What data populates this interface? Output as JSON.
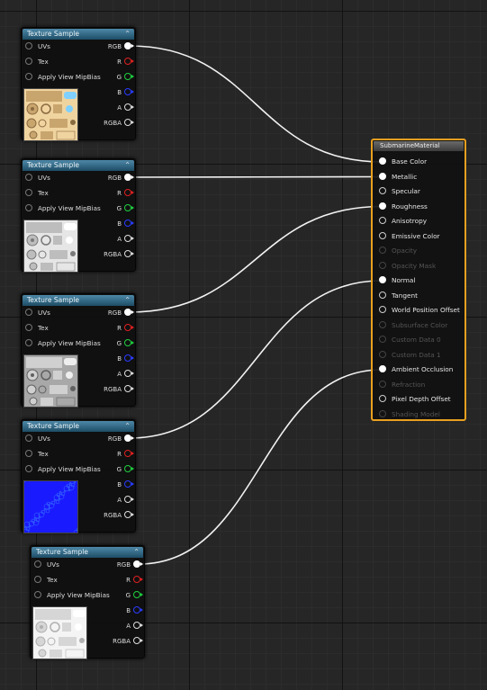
{
  "texture_nodes": [
    {
      "title": "Texture Sample",
      "inputs": [
        "UVs",
        "Tex",
        "Apply View MipBias"
      ],
      "outputs": [
        "RGB",
        "R",
        "G",
        "B",
        "A",
        "RGBA"
      ],
      "preview": "beige-diffuse-map"
    },
    {
      "title": "Texture Sample",
      "inputs": [
        "UVs",
        "Tex",
        "Apply View MipBias"
      ],
      "outputs": [
        "RGB",
        "R",
        "G",
        "B",
        "A",
        "RGBA"
      ],
      "preview": "grey-metallic-map"
    },
    {
      "title": "Texture Sample",
      "inputs": [
        "UVs",
        "Tex",
        "Apply View MipBias"
      ],
      "outputs": [
        "RGB",
        "R",
        "G",
        "B",
        "A",
        "RGBA"
      ],
      "preview": "grey-roughness-map"
    },
    {
      "title": "Texture Sample",
      "inputs": [
        "UVs",
        "Tex",
        "Apply View MipBias"
      ],
      "outputs": [
        "RGB",
        "R",
        "G",
        "B",
        "A",
        "RGBA"
      ],
      "preview": "blue-normal-map"
    },
    {
      "title": "Texture Sample",
      "inputs": [
        "UVs",
        "Tex",
        "Apply View MipBias"
      ],
      "outputs": [
        "RGB",
        "R",
        "G",
        "B",
        "A",
        "RGBA"
      ],
      "preview": "white-ao-map"
    }
  ],
  "material": {
    "title": "SubmarineMaterial",
    "pins": [
      {
        "label": "Base Color",
        "state": "connected"
      },
      {
        "label": "Metallic",
        "state": "connected"
      },
      {
        "label": "Specular",
        "state": "active"
      },
      {
        "label": "Roughness",
        "state": "connected"
      },
      {
        "label": "Anisotropy",
        "state": "active"
      },
      {
        "label": "Emissive Color",
        "state": "active"
      },
      {
        "label": "Opacity",
        "state": "disabled"
      },
      {
        "label": "Opacity Mask",
        "state": "disabled"
      },
      {
        "label": "Normal",
        "state": "connected"
      },
      {
        "label": "Tangent",
        "state": "active"
      },
      {
        "label": "World Position Offset",
        "state": "active"
      },
      {
        "label": "Subsurface Color",
        "state": "disabled"
      },
      {
        "label": "Custom Data 0",
        "state": "disabled"
      },
      {
        "label": "Custom Data 1",
        "state": "disabled"
      },
      {
        "label": "Ambient Occlusion",
        "state": "connected"
      },
      {
        "label": "Refraction",
        "state": "disabled"
      },
      {
        "label": "Pixel Depth Offset",
        "state": "active"
      },
      {
        "label": "Shading Model",
        "state": "disabled"
      }
    ]
  },
  "connections": [
    {
      "from_node": 0,
      "to_pin": "Base Color"
    },
    {
      "from_node": 1,
      "to_pin": "Metallic"
    },
    {
      "from_node": 2,
      "to_pin": "Roughness"
    },
    {
      "from_node": 3,
      "to_pin": "Normal"
    },
    {
      "from_node": 4,
      "to_pin": "Ambient Occlusion"
    }
  ],
  "colors": {
    "accent_selected": "#e8a020",
    "node_header": "#2b6586",
    "pin_r": "#e02020",
    "pin_g": "#20d040",
    "pin_b": "#2a3cff"
  }
}
